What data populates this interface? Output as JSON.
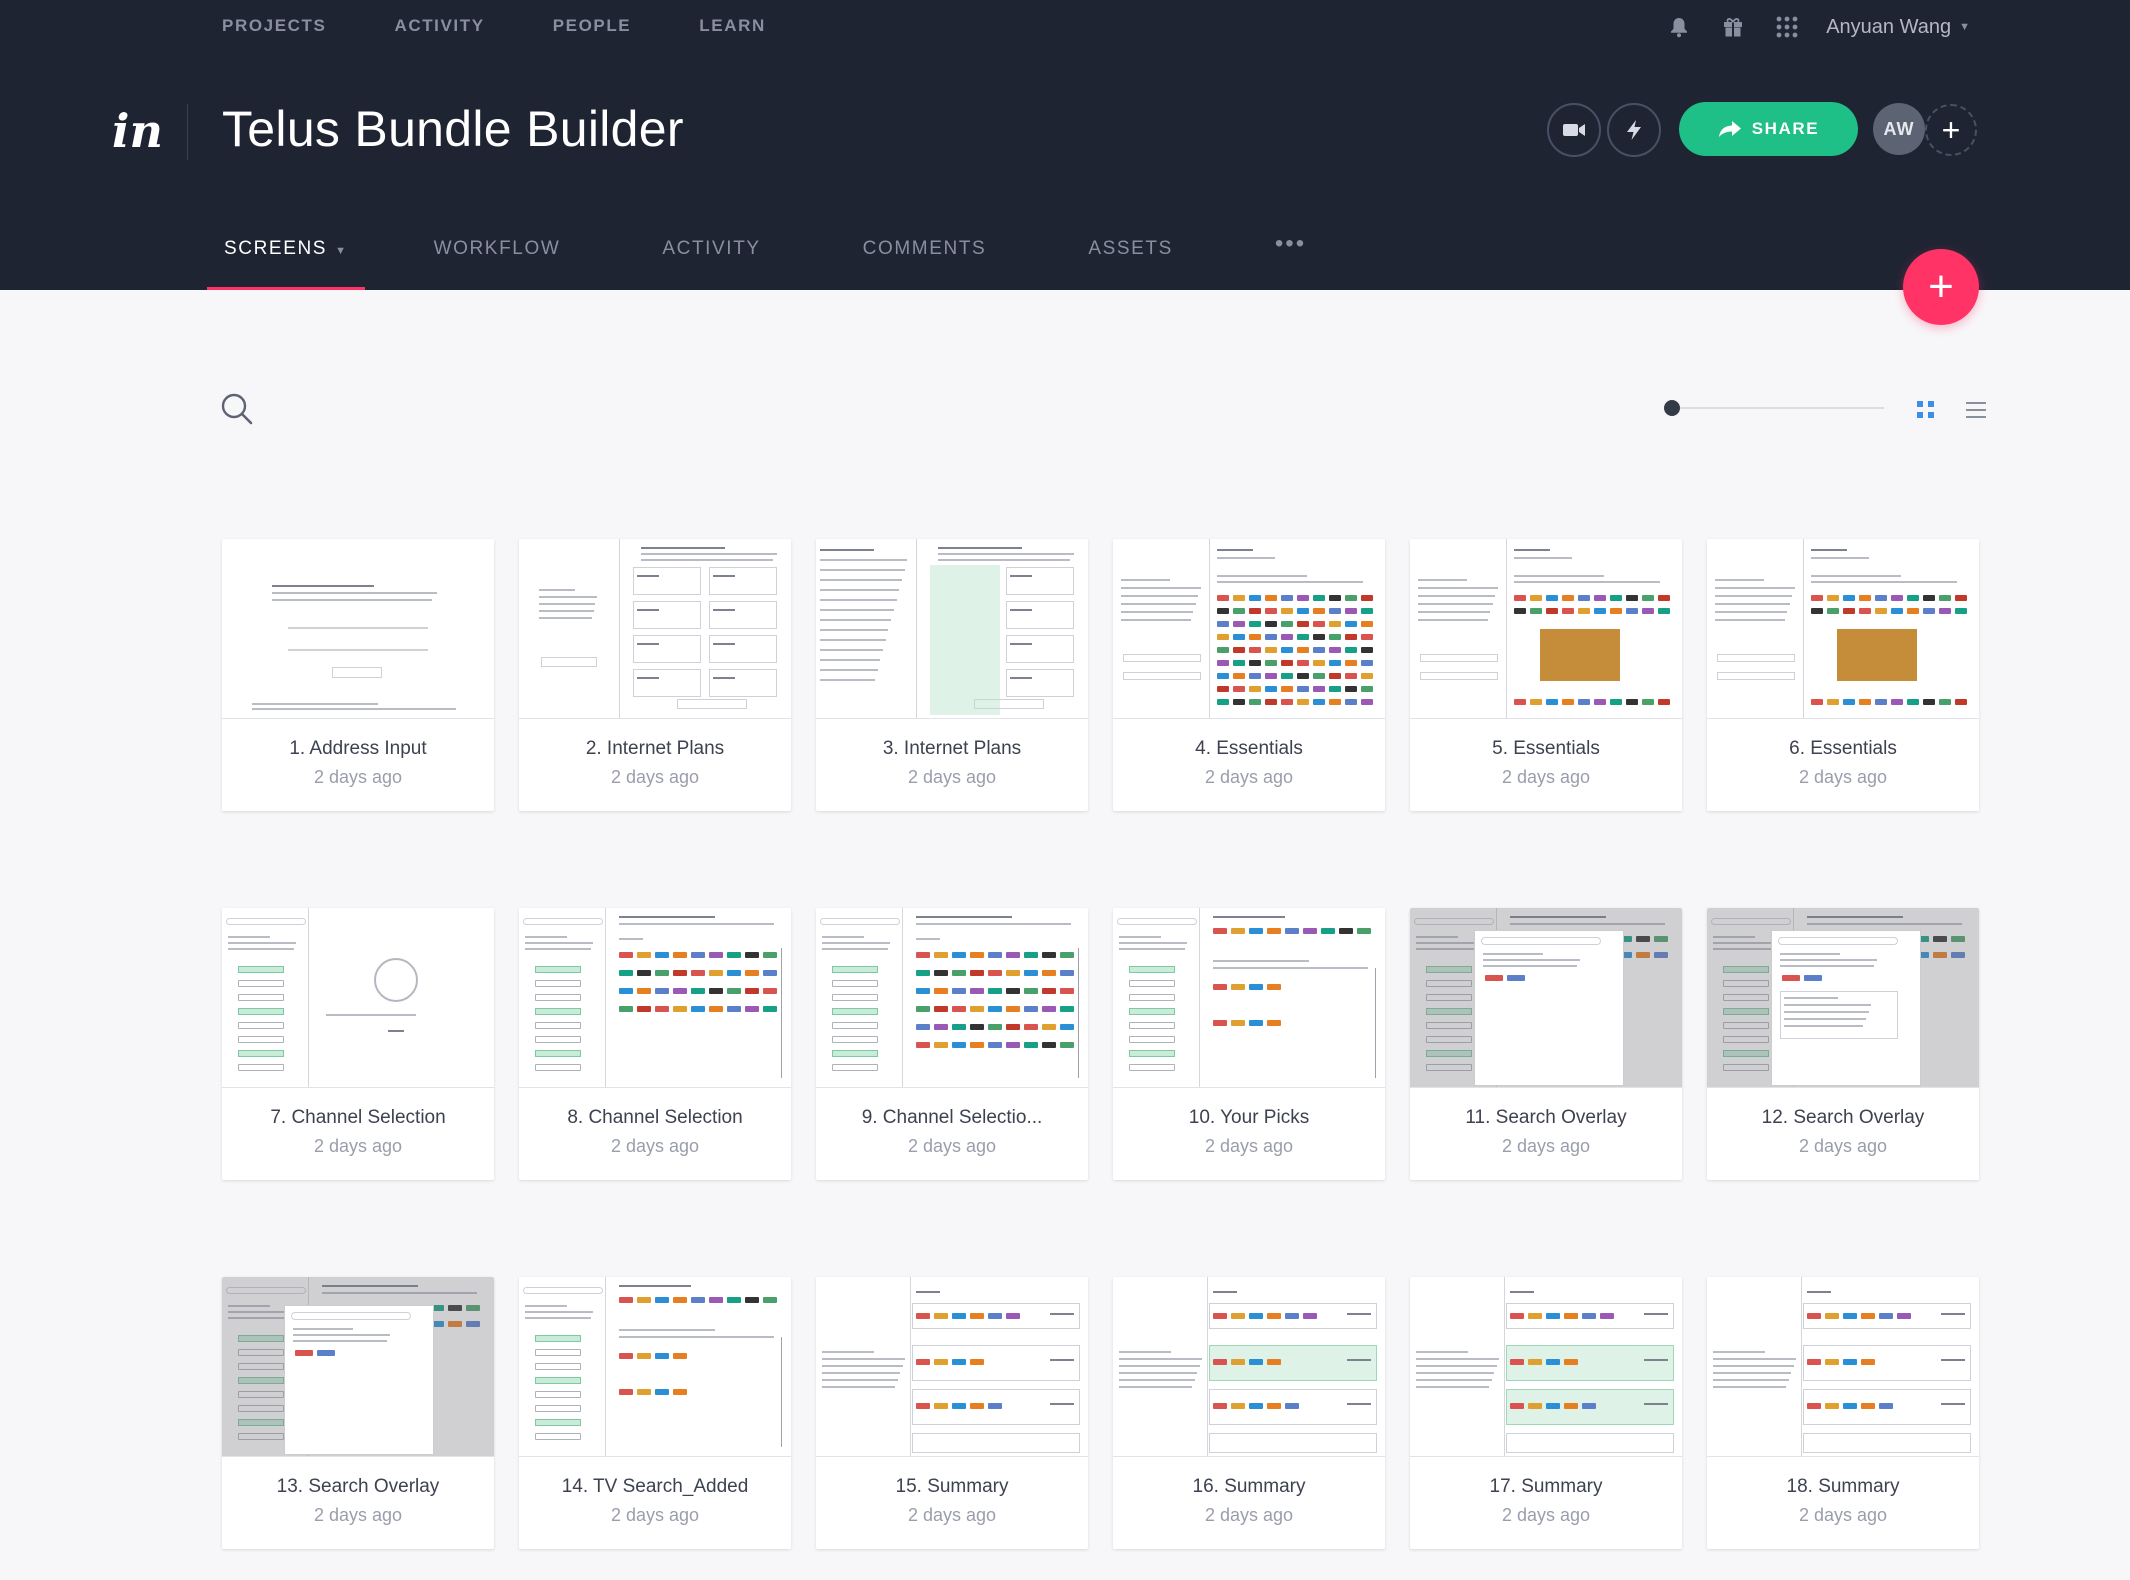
{
  "nav": {
    "items": [
      "PROJECTS",
      "ACTIVITY",
      "PEOPLE",
      "LEARN"
    ],
    "user_name": "Anyuan Wang"
  },
  "project": {
    "title": "Telus Bundle Builder",
    "logo": "in",
    "share_label": "SHARE",
    "avatar_initials": "AW"
  },
  "tabs": [
    "SCREENS",
    "WORKFLOW",
    "ACTIVITY",
    "COMMENTS",
    "ASSETS",
    "•••"
  ],
  "colors": {
    "header_bg": "#1f2433",
    "share_green": "#1fbf88",
    "accent_pink": "#ff3366"
  },
  "screens": [
    {
      "title": "1. Address Input",
      "date": "2 days ago"
    },
    {
      "title": "2. Internet Plans",
      "date": "2 days ago"
    },
    {
      "title": "3. Internet Plans",
      "date": "2 days ago"
    },
    {
      "title": "4. Essentials",
      "date": "2 days ago"
    },
    {
      "title": "5. Essentials",
      "date": "2 days ago"
    },
    {
      "title": "6. Essentials",
      "date": "2 days ago"
    },
    {
      "title": "7. Channel Selection",
      "date": "2 days ago"
    },
    {
      "title": "8. Channel Selection",
      "date": "2 days ago"
    },
    {
      "title": "9. Channel Selectio...",
      "date": "2 days ago"
    },
    {
      "title": "10. Your Picks",
      "date": "2 days ago"
    },
    {
      "title": "11. Search Overlay",
      "date": "2 days ago"
    },
    {
      "title": "12. Search Overlay",
      "date": "2 days ago"
    },
    {
      "title": "13. Search Overlay",
      "date": "2 days ago"
    },
    {
      "title": "14. TV Search_Added",
      "date": "2 days ago"
    },
    {
      "title": "15. Summary",
      "date": "2 days ago"
    },
    {
      "title": "16. Summary",
      "date": "2 days ago"
    },
    {
      "title": "17. Summary",
      "date": "2 days ago"
    },
    {
      "title": "18. Summary",
      "date": "2 days ago"
    }
  ],
  "icons": {
    "notifications": "bell-icon",
    "gifts": "gift-icon",
    "apps": "apps-grid-icon",
    "record": "video-camera-icon",
    "lightning": "lightning-icon",
    "share": "share-arrow-icon",
    "add_person": "plus-icon",
    "add_screen": "plus-icon",
    "search": "search-icon",
    "grid_view": "grid-view-icon",
    "list_view": "list-view-icon"
  }
}
